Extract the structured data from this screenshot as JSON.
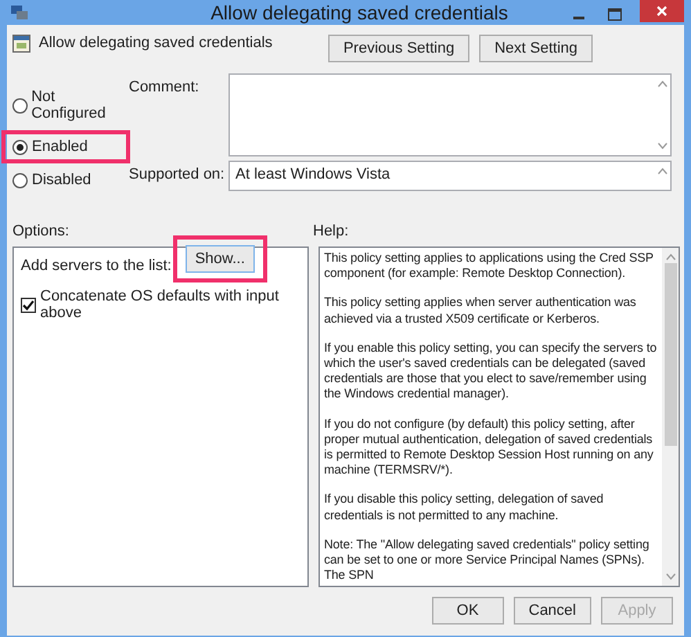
{
  "window": {
    "title": "Allow delegating saved credentials"
  },
  "header": {
    "policy_name": "Allow delegating saved credentials",
    "buttons": [
      "Previous Setting",
      "Next Setting"
    ]
  },
  "state_options": [
    {
      "label": "Not Configured",
      "selected": false
    },
    {
      "label": "Enabled",
      "selected": true
    },
    {
      "label": "Disabled",
      "selected": false
    }
  ],
  "comment": {
    "label": "Comment:"
  },
  "supported_on": {
    "label": "Supported on:",
    "value": "At least Windows Vista"
  },
  "options": {
    "label": "Options:",
    "add_servers_label": "Add servers to the list:",
    "show_button": "Show...",
    "concatenate": {
      "label": "Concatenate OS defaults with input above",
      "checked": true
    }
  },
  "help": {
    "label": "Help:",
    "paragraphs": [
      "This policy setting applies to applications using the Cred SSP component (for example: Remote Desktop Connection).",
      "This policy setting applies when server authentication was achieved via a trusted X509 certificate or Kerberos.",
      "If you enable this policy setting, you can specify the servers to which the user's saved credentials can be delegated (saved credentials are those that you elect to save/remember using the Windows credential manager).",
      "If you do not configure (by default) this policy setting, after proper mutual authentication, delegation of saved credentials is permitted to Remote Desktop Session Host running on any machine (TERMSRV/*).",
      "If you disable this policy setting, delegation of saved credentials is not permitted to any machine.",
      "Note: The \"Allow delegating saved credentials\" policy setting can be set to one or more Service Principal Names (SPNs). The SPN"
    ]
  },
  "buttons": [
    {
      "label": "OK",
      "disabled": false
    },
    {
      "label": "Cancel",
      "disabled": false
    },
    {
      "label": "Apply",
      "disabled": true
    }
  ]
}
